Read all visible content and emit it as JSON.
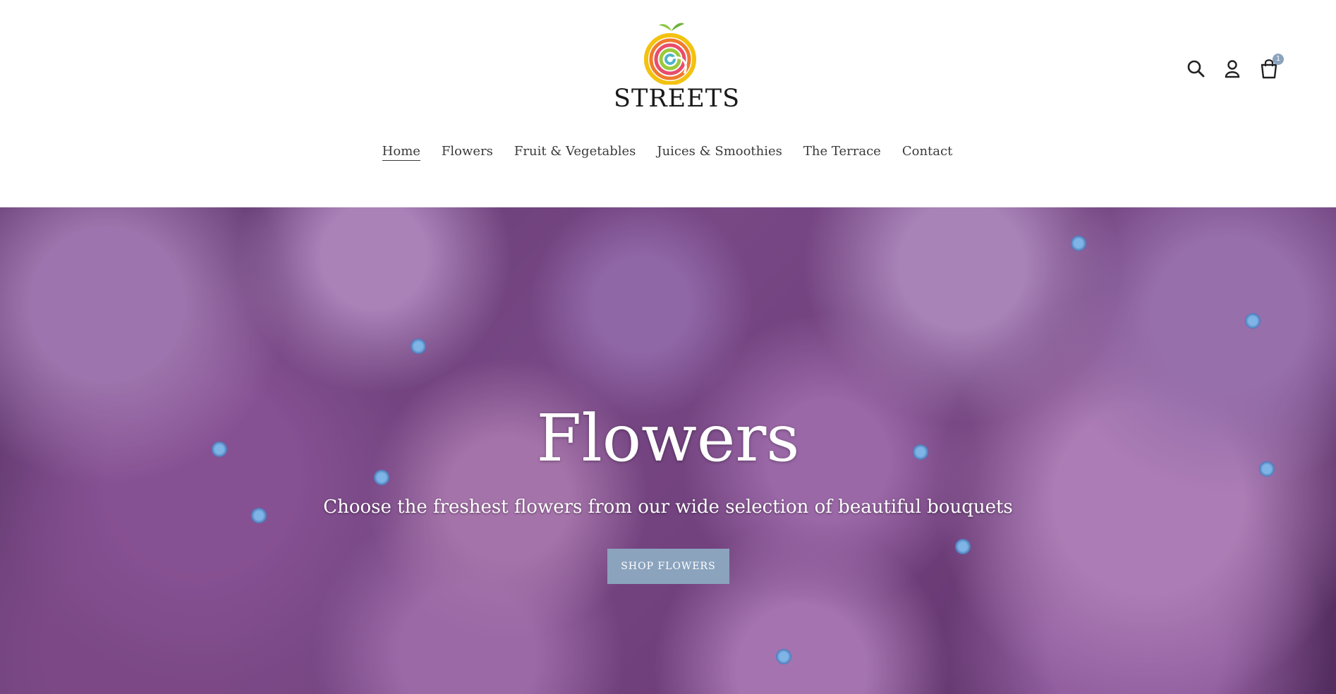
{
  "brand": {
    "name": "STREETS"
  },
  "header": {
    "icons": [
      "search-icon",
      "account-icon",
      "cart-icon"
    ],
    "cart_count": "1"
  },
  "nav": {
    "items": [
      {
        "label": "Home",
        "active": true
      },
      {
        "label": "Flowers"
      },
      {
        "label": "Fruit & Vegetables"
      },
      {
        "label": "Juices & Smoothies"
      },
      {
        "label": "The Terrace"
      },
      {
        "label": "Contact"
      }
    ]
  },
  "hero": {
    "title": "Flowers",
    "subtitle": "Choose the freshest flowers from our wide selection of beautiful bouquets",
    "button_label": "SHOP FLOWERS"
  },
  "colors": {
    "accent": "#8ba3bd",
    "text": "#3a3a3a",
    "hero_purple": "#8a5398"
  }
}
